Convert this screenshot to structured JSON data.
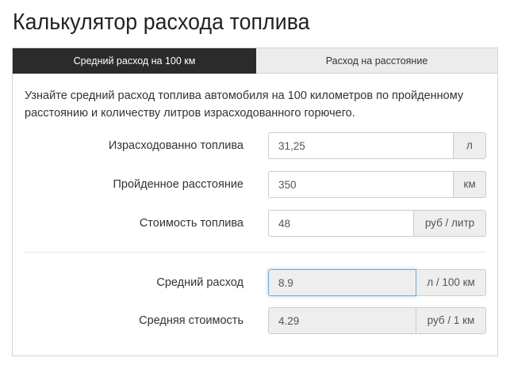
{
  "page": {
    "title": "Калькулятор расхода топлива"
  },
  "tabs": [
    {
      "label": "Средний расход на 100 км",
      "active": true
    },
    {
      "label": "Расход на расстояние",
      "active": false
    }
  ],
  "description": "Узнайте средний расход топлива автомобиля на 100 километров по пройденному расстоянию и количеству литров израсходованного горючего.",
  "fields": {
    "fuel_used": {
      "label": "Израсходованно топлива",
      "value": "31,25",
      "unit": "л"
    },
    "distance": {
      "label": "Пройденное расстояние",
      "value": "350",
      "unit": "км"
    },
    "fuel_cost": {
      "label": "Стоимость топлива",
      "value": "48",
      "unit": "руб / литр"
    }
  },
  "results": {
    "avg_consumption": {
      "label": "Средний расход",
      "value": "8.9",
      "unit": "л / 100 км"
    },
    "avg_cost": {
      "label": "Средняя стоимость",
      "value": "4.29",
      "unit": "руб / 1 км"
    }
  },
  "colors": {
    "active_tab": "#2b2b2b",
    "inactive_tab": "#ececec",
    "focus_border": "#66afe9",
    "addon_bg": "#eeeeee"
  }
}
